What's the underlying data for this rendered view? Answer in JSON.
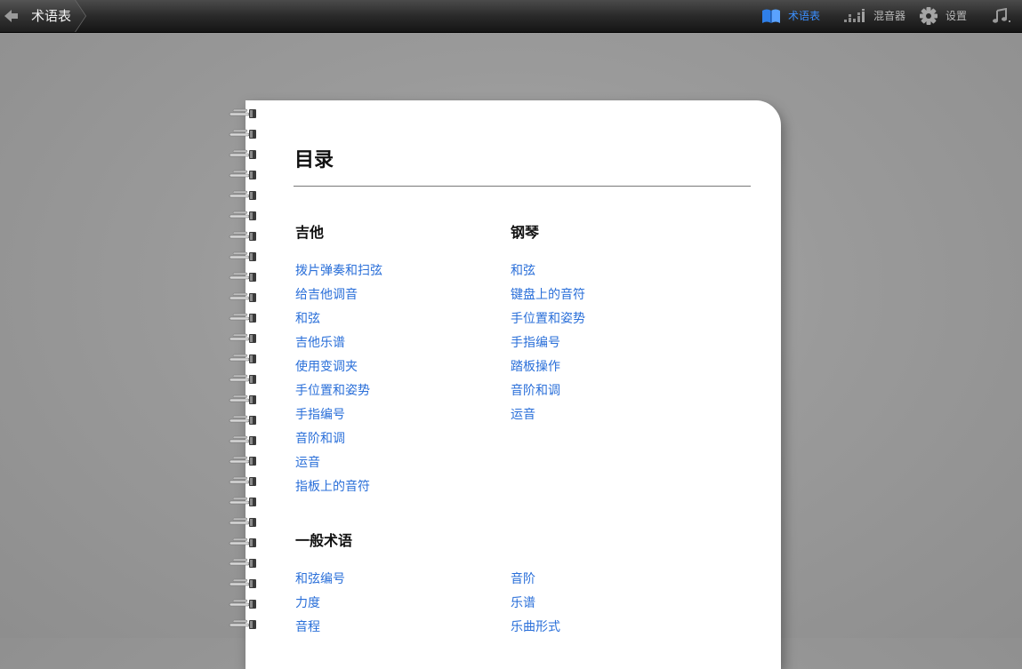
{
  "header": {
    "back_label": "术语表",
    "nav": [
      {
        "label": "术语表",
        "icon": "book-icon",
        "active": true
      },
      {
        "label": "混音器",
        "icon": "mixer-icon",
        "active": false
      },
      {
        "label": "设置",
        "icon": "gear-icon",
        "active": false
      }
    ],
    "music_icon": "music-note-icon",
    "accent_color": "#3b8fff"
  },
  "toc": {
    "title": "目录",
    "sections": {
      "guitar": {
        "heading": "吉他",
        "items": [
          "拨片弹奏和扫弦",
          "给吉他调音",
          "和弦",
          "吉他乐谱",
          "使用变调夹",
          "手位置和姿势",
          "手指编号",
          "音阶和调",
          "运音",
          "指板上的音符"
        ]
      },
      "piano": {
        "heading": "钢琴",
        "items": [
          "和弦",
          "键盘上的音符",
          "手位置和姿势",
          "手指编号",
          "踏板操作",
          "音阶和调",
          "运音"
        ]
      },
      "general": {
        "heading": "一般术语",
        "items_left": [
          "和弦编号",
          "力度",
          "音程"
        ],
        "items_right": [
          "音阶",
          "乐谱",
          "乐曲形式"
        ]
      }
    }
  },
  "link_color": "#2a6fd9"
}
